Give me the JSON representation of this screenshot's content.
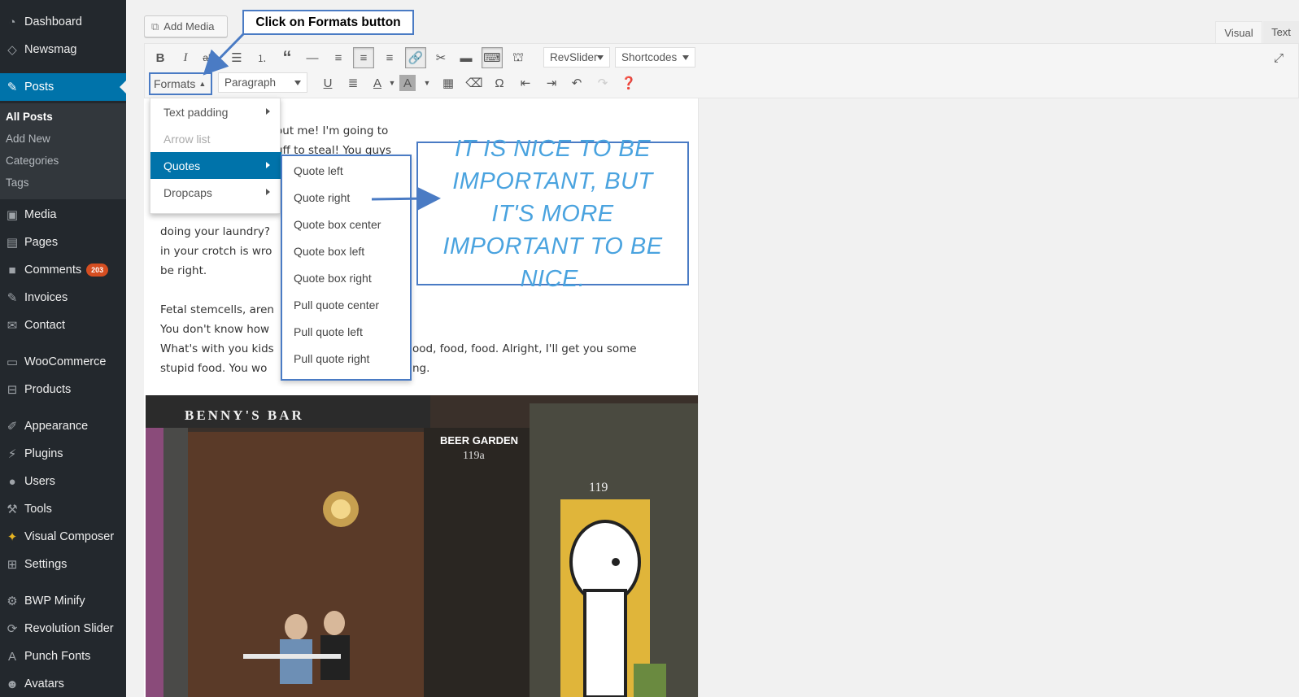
{
  "sidebar": {
    "items": [
      {
        "label": "Dashboard",
        "icon": "dashboard-icon"
      },
      {
        "label": "Newsmag",
        "icon": "newsmag-icon"
      },
      {
        "label": "Posts",
        "icon": "pin-icon"
      },
      {
        "label": "Media",
        "icon": "media-icon"
      },
      {
        "label": "Pages",
        "icon": "pages-icon"
      },
      {
        "label": "Comments",
        "icon": "comments-icon",
        "badge": "203"
      },
      {
        "label": "Invoices",
        "icon": "pin-icon"
      },
      {
        "label": "Contact",
        "icon": "mail-icon"
      },
      {
        "label": "WooCommerce",
        "icon": "woo-icon"
      },
      {
        "label": "Products",
        "icon": "cart-icon"
      },
      {
        "label": "Appearance",
        "icon": "brush-icon"
      },
      {
        "label": "Plugins",
        "icon": "plugin-icon"
      },
      {
        "label": "Users",
        "icon": "user-icon"
      },
      {
        "label": "Tools",
        "icon": "wrench-icon"
      },
      {
        "label": "Visual Composer",
        "icon": "vc-icon"
      },
      {
        "label": "Settings",
        "icon": "settings-icon"
      },
      {
        "label": "BWP Minify",
        "icon": "gear-icon"
      },
      {
        "label": "Revolution Slider",
        "icon": "refresh-icon"
      },
      {
        "label": "Punch Fonts",
        "icon": "font-icon"
      },
      {
        "label": "Avatars",
        "icon": "avatar-icon"
      }
    ],
    "submenu": [
      "All Posts",
      "Add New",
      "Categories",
      "Tags"
    ]
  },
  "editor": {
    "add_media": "Add Media",
    "tabs": [
      "Visual",
      "Text"
    ],
    "formats_label": "Formats",
    "paragraph_label": "Paragraph",
    "revslider_label": "RevSlider",
    "shortcodes_label": "Shortcodes"
  },
  "content": {
    "lines": [
      "out me! I'm going to",
      "uff to steal! You guys",
      "doing your laundry?",
      "in your crotch is wro",
      "be right.",
      "Fetal stemcells, aren",
      "You don't know how",
      "What's with you kids",
      "ood, food, food. Alright, I'll get you some",
      "stupid food. You wo",
      "ng."
    ]
  },
  "formats_menu": {
    "items": [
      "Text padding",
      "Arrow list",
      "Quotes",
      "Dropcaps"
    ]
  },
  "quotes_menu": {
    "items": [
      "Quote left",
      "Quote right",
      "Quote box center",
      "Quote box left",
      "Quote box right",
      "Pull quote center",
      "Pull quote left",
      "Pull quote right"
    ]
  },
  "annotation": {
    "callout": "Click on Formats button",
    "quote": "IT IS NICE TO BE IMPORTANT, BUT IT'S MORE IMPORTANT TO BE NICE."
  },
  "photo": {
    "sign_bar": "BENNY'S BAR",
    "sign_garden": "BEER GARDEN",
    "sign_number": "119a",
    "door_number": "119"
  },
  "colors": {
    "sidebar_bg": "#23282d",
    "accent": "#0073aa",
    "annotation_border": "#4a7bc4",
    "quote_text": "#4aa3df",
    "badge": "#d54e21"
  }
}
